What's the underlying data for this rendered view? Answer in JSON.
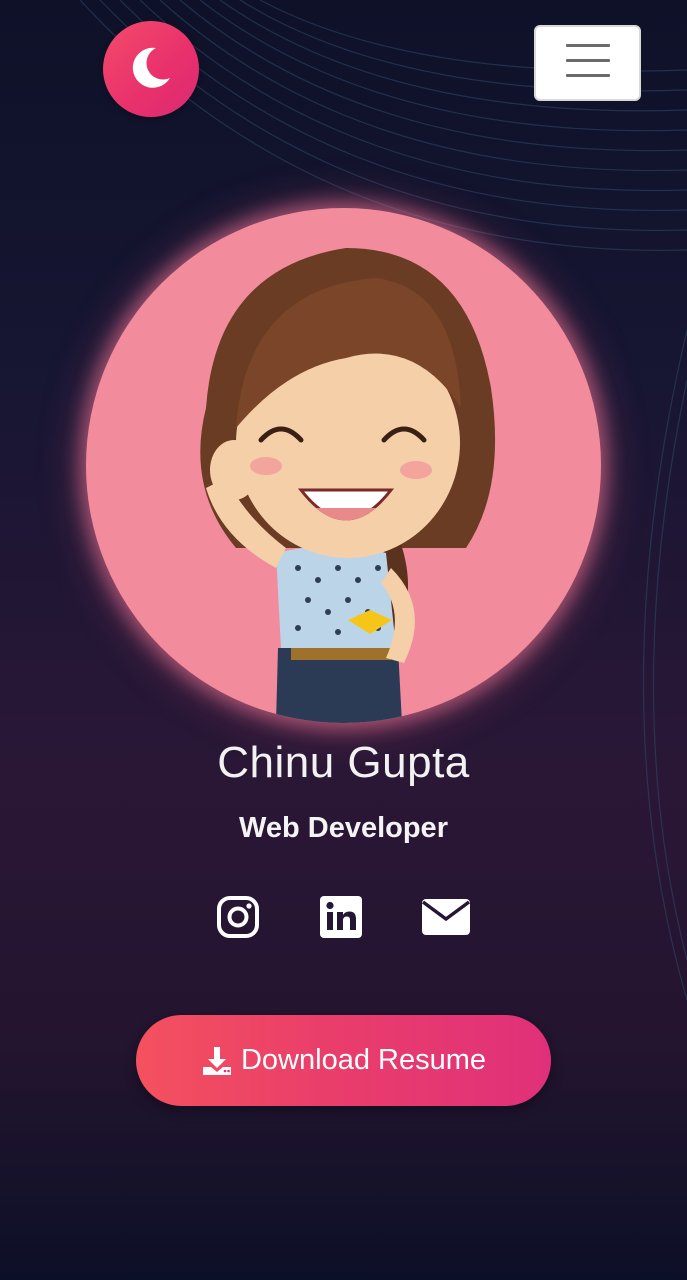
{
  "header": {
    "logo_icon": "moon-icon",
    "menu_icon": "hamburger-menu-icon"
  },
  "profile": {
    "avatar_description_icon": "avatar-illustration",
    "name": "Chinu Gupta",
    "role": "Web Developer"
  },
  "social_links": [
    {
      "icon": "instagram-icon"
    },
    {
      "icon": "linkedin-icon"
    },
    {
      "icon": "email-icon"
    }
  ],
  "cta": {
    "icon": "download-icon",
    "label": "Download Resume"
  },
  "colors": {
    "accent": "#e8306c",
    "accent_start": "#f4515f",
    "avatar_bg": "#f28c9c",
    "background": "#171633"
  }
}
